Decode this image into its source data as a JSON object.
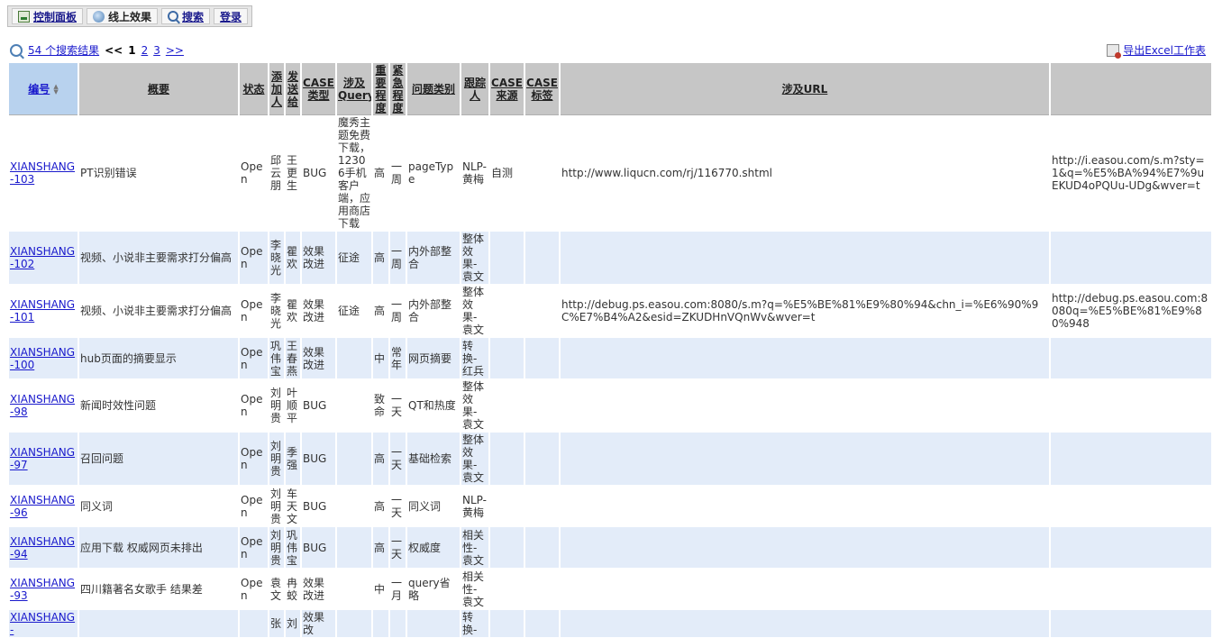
{
  "toolbar": {
    "buttons": [
      {
        "label": "控制面板",
        "icon": "dashboard-icon"
      },
      {
        "label": "线上效果",
        "icon": "globe-icon"
      },
      {
        "label": "搜索",
        "icon": "search-icon"
      },
      {
        "label": "登录",
        "icon": ""
      }
    ]
  },
  "pager": {
    "results": "54 个搜索结果",
    "prev": "<<",
    "current": "1",
    "page2": "2",
    "page3": "3",
    "next": ">>"
  },
  "export": {
    "label": "导出Excel工作表"
  },
  "table": {
    "headers": [
      "编号",
      "概要",
      "状态",
      "添加人",
      "发送给",
      "CASE类型",
      "涉及Query",
      "重要程度",
      "紧急程度",
      "问题类别",
      "跟踪人",
      "CASE来源",
      "CASE标签",
      "涉及URL",
      ""
    ],
    "rows": [
      {
        "id": "XIANSHANG-103",
        "summary": "PT识别错误",
        "status": "Open",
        "adder": "邱云朋",
        "sendto": "王更生",
        "type": "BUG",
        "query": "魔秀主题免费下载，12306手机客户端，应用商店下载",
        "importance": "高",
        "urgency": "一周",
        "category": "pageType",
        "tracker": "NLP-黄梅",
        "source": "自测",
        "tag": "",
        "url": "http://www.liqucn.com/rj/116770.shtml",
        "url2": "http://i.easou.com/s.m?sty=1&q=%E5%BA%94%E7%9uEKUD4oPQUu-UDg&wver=t"
      },
      {
        "id": "XIANSHANG-102",
        "summary": "视频、小说非主要需求打分偏高",
        "status": "Open",
        "adder": "李晓光",
        "sendto": "瞿欢",
        "type": "效果改进",
        "query": "征途",
        "importance": "高",
        "urgency": "一周",
        "category": "内外部整合",
        "tracker": "整体效果-袁文",
        "source": "",
        "tag": "",
        "url": "",
        "url2": ""
      },
      {
        "id": "XIANSHANG-101",
        "summary": "视频、小说非主要需求打分偏高",
        "status": "Open",
        "adder": "李晓光",
        "sendto": "瞿欢",
        "type": "效果改进",
        "query": "征途",
        "importance": "高",
        "urgency": "一周",
        "category": "内外部整合",
        "tracker": "整体效果-袁文",
        "source": "",
        "tag": "",
        "url": "http://debug.ps.easou.com:8080/s.m?q=%E5%BE%81%E9%80%94&chn_i=%E6%90%9C%E7%B4%A2&esid=ZKUDHnVQnWv&wver=t",
        "url2": "http://debug.ps.easou.com:8080q=%E5%BE%81%E9%80%948"
      },
      {
        "id": "XIANSHANG-100",
        "summary": "hub页面的摘要显示",
        "status": "Open",
        "adder": "巩伟宝",
        "sendto": "王春燕",
        "type": "效果改进",
        "query": "",
        "importance": "中",
        "urgency": "常年",
        "category": "网页摘要",
        "tracker": "转换-红兵",
        "source": "",
        "tag": "",
        "url": "",
        "url2": ""
      },
      {
        "id": "XIANSHANG-98",
        "summary": "新闻时效性问题",
        "status": "Open",
        "adder": "刘明贵",
        "sendto": "叶顺平",
        "type": "BUG",
        "query": "",
        "importance": "致命",
        "urgency": "一天",
        "category": "QT和热度",
        "tracker": "整体效果-袁文",
        "source": "",
        "tag": "",
        "url": "",
        "url2": ""
      },
      {
        "id": "XIANSHANG-97",
        "summary": "召回问题",
        "status": "Open",
        "adder": "刘明贵",
        "sendto": "季强",
        "type": "BUG",
        "query": "",
        "importance": "高",
        "urgency": "一天",
        "category": "基础检索",
        "tracker": "整体效果-袁文",
        "source": "",
        "tag": "",
        "url": "",
        "url2": ""
      },
      {
        "id": "XIANSHANG-96",
        "summary": "同义词",
        "status": "Open",
        "adder": "刘明贵",
        "sendto": "车天文",
        "type": "BUG",
        "query": "",
        "importance": "高",
        "urgency": "一天",
        "category": "同义词",
        "tracker": "NLP-黄梅",
        "source": "",
        "tag": "",
        "url": "",
        "url2": ""
      },
      {
        "id": "XIANSHANG-94",
        "summary": "应用下载 权威网页未排出",
        "status": "Open",
        "adder": "刘明贵",
        "sendto": "巩伟宝",
        "type": "BUG",
        "query": "",
        "importance": "高",
        "urgency": "一天",
        "category": "权威度",
        "tracker": "相关性-袁文",
        "source": "",
        "tag": "",
        "url": "",
        "url2": ""
      },
      {
        "id": "XIANSHANG-93",
        "summary": "四川籍著名女歌手 结果差",
        "status": "Open",
        "adder": "袁文",
        "sendto": "冉蛟",
        "type": "效果改进",
        "query": "",
        "importance": "中",
        "urgency": "一月",
        "category": "query省略",
        "tracker": "相关性-袁文",
        "source": "",
        "tag": "",
        "url": "",
        "url2": ""
      },
      {
        "id": "XIANSHANG-",
        "summary": "",
        "status": "",
        "adder": "张",
        "sendto": "刘",
        "type": "效果改",
        "query": "",
        "importance": "",
        "urgency": "",
        "category": "",
        "tracker": "转换-",
        "source": "",
        "tag": "",
        "url": "",
        "url2": ""
      }
    ]
  }
}
